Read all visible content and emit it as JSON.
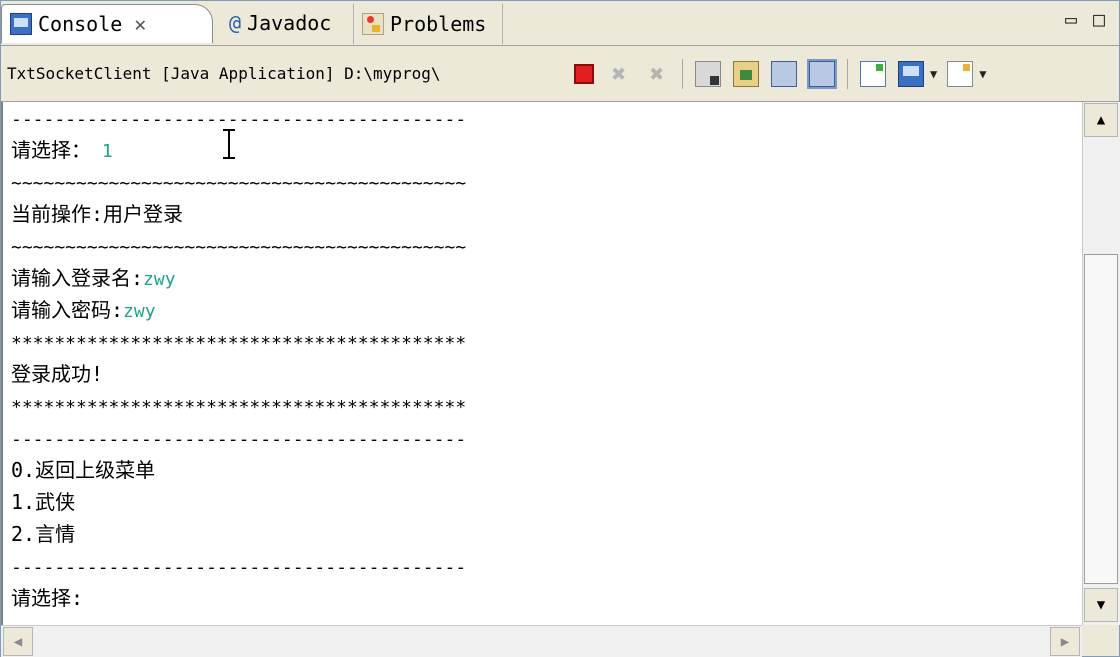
{
  "tabs": [
    {
      "label": "Console",
      "close": "✕",
      "icon": "console-icon",
      "active": true
    },
    {
      "label": "Javadoc",
      "icon": "at-sign-icon"
    },
    {
      "label": "Problems",
      "icon": "problems-icon"
    }
  ],
  "window_controls": {
    "minimize": "▭",
    "maximize": "□"
  },
  "toolbar": {
    "title": "TxtSocketClient [Java Application] D:\\myprog\\"
  },
  "console": {
    "lines": [
      {
        "type": "sep",
        "text": "------------------------------------------"
      },
      {
        "type": "prompt",
        "text": "请选择：",
        "input": "1"
      },
      {
        "type": "sep",
        "text": "~~~~~~~~~~~~~~~~~~~~~~~~~~~~~~~~~~~~~~~~~~"
      },
      {
        "type": "text",
        "text": "当前操作:用户登录"
      },
      {
        "type": "sep",
        "text": "~~~~~~~~~~~~~~~~~~~~~~~~~~~~~~~~~~~~~~~~~~"
      },
      {
        "type": "prompt",
        "text": "请输入登录名:",
        "input": "zwy"
      },
      {
        "type": "prompt",
        "text": "请输入密码:",
        "input": "zwy"
      },
      {
        "type": "sep",
        "text": "******************************************"
      },
      {
        "type": "text",
        "text": "登录成功!"
      },
      {
        "type": "sep",
        "text": "******************************************"
      },
      {
        "type": "sep",
        "text": "------------------------------------------"
      },
      {
        "type": "text",
        "text": "0.返回上级菜单"
      },
      {
        "type": "text",
        "text": "1.武侠"
      },
      {
        "type": "text",
        "text": "2.言情"
      },
      {
        "type": "sep",
        "text": "------------------------------------------"
      },
      {
        "type": "text",
        "text": "请选择:"
      }
    ]
  },
  "scroll": {
    "up": "▲",
    "down": "▼",
    "left": "◀",
    "right": "▶"
  }
}
